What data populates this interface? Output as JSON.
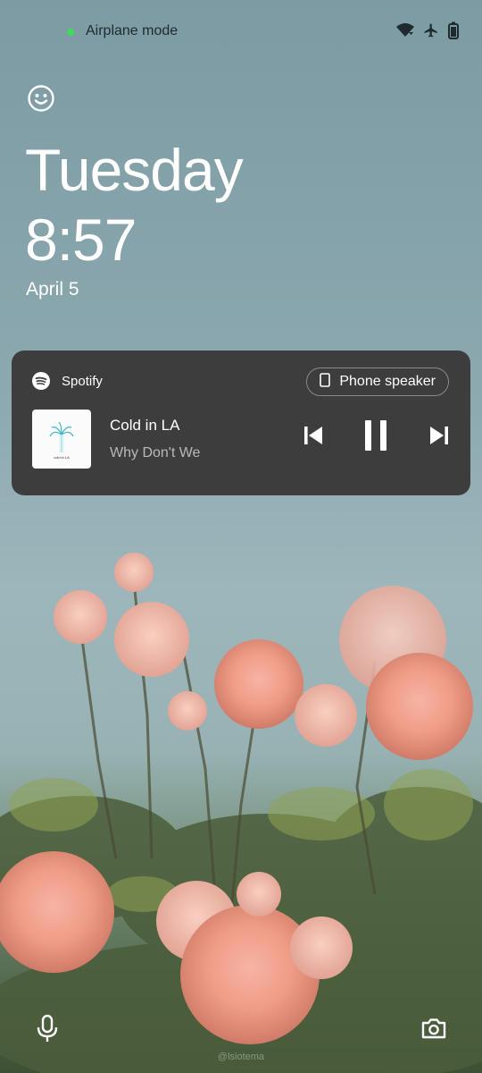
{
  "status_bar": {
    "mode_text": "Airplane mode",
    "icons": [
      "wifi-icon",
      "airplane-icon",
      "battery-icon"
    ],
    "dot_color": "#3ddc5c"
  },
  "lockscreen": {
    "weekday": "Tuesday",
    "time": "8:57",
    "date": "April 5"
  },
  "media": {
    "app_name": "Spotify",
    "output_label": "Phone speaker",
    "track_title": "Cold in LA",
    "artist": "Why Don't We",
    "album_art_text": "cold in LA",
    "card_color": "#3d3d3d",
    "controls": [
      "skip-previous-icon",
      "pause-icon",
      "skip-next-icon"
    ]
  },
  "shortcuts": {
    "left": "microphone-icon",
    "right": "camera-icon"
  },
  "watermark": "@lsiotema"
}
